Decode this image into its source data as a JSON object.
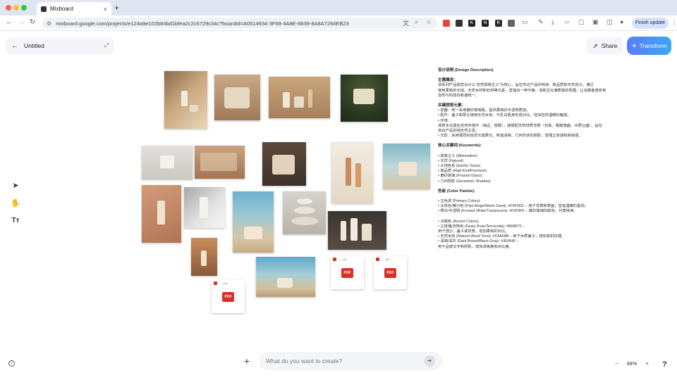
{
  "browser": {
    "tab_title": "Mixboard",
    "tab_close": "×",
    "new_tab": "+",
    "url": "mixboard.google.com/projects/e124a9e102b84bd1bfea2c2c6729c34c?boardId=A0514934-3F68-4A8E-8839-8A8A7284EB23",
    "finish_update": "Finish update",
    "extensions": [
      {
        "name": "pdf-extension-icon",
        "label": "",
        "color": "#e8453c"
      },
      {
        "name": "lock-extension-icon",
        "label": "",
        "color": "#333333"
      },
      {
        "name": "k-extension-icon",
        "label": "K",
        "color": "#222222"
      },
      {
        "name": "n-extension-icon",
        "label": "N",
        "color": "#1e1e1e"
      },
      {
        "name": "k2-extension-icon",
        "label": "K",
        "color": "#2b2b2b"
      },
      {
        "name": "puzzle-extension-icon",
        "label": "",
        "color": "#5f6368"
      }
    ]
  },
  "app": {
    "project_title": "Untitled",
    "share_label": "Share",
    "transform_label": "Transform",
    "prompt_placeholder": "What do you want to create?",
    "zoom_level": "48%",
    "zoom_minus": "−",
    "zoom_plus": "+",
    "help": "?",
    "pdf_label": "PDF",
    "pdf_filename": "......pdf",
    "accent_color": "#4a8ff7"
  },
  "description": [
    {
      "t": "h",
      "text": "设计说明 (Design Description)"
    },
    {
      "t": "gap"
    },
    {
      "t": "h",
      "text": "主题概念："
    },
    {
      "t": "p",
      "text": "该系列产品视觉设计以“自然极简主义”为核心，旨在传达产品的纯净、高品质和天然成分。通过"
    },
    {
      "t": "p",
      "text": "使用柔和的光线、天然木材和石材等元素，营造出一种平静、清新且充满质感的氛围，让消费者感受到"
    },
    {
      "t": "p",
      "text": "自然与科技的和谐统一。"
    },
    {
      "t": "gap"
    },
    {
      "t": "h",
      "text": "关键视觉元素："
    },
    {
      "t": "p",
      "text": "• 容器：统一采用磨砂玻璃瓶，提供柔和的半透明质感。"
    },
    {
      "t": "p",
      "text": "• 配件：盖子和泵头使用天然木色，与乳白瓶身形成对比，增加自然温暖的触感。"
    },
    {
      "t": "p",
      "text": "• 环境："
    },
    {
      "t": "p",
      "text": "场景多设置在自然环境中（海边、苔藓），或搭配天然材质背景（石板、粗糙墙面、木质台面），旨在"
    },
    {
      "t": "p",
      "text": "突出产品的纯天然主张。"
    },
    {
      "t": "p",
      "text": "• 光影：采用强烈的自然光或柔光，制造清晰、几何形状的阴影，增强立体感和高级感。"
    },
    {
      "t": "gap"
    },
    {
      "t": "h",
      "text": "核心关键词 (Keywords):"
    },
    {
      "t": "gap"
    },
    {
      "t": "p",
      "text": "• 极简主义 (Minimalism)"
    },
    {
      "t": "p",
      "text": "• 天然 (Natural)"
    },
    {
      "t": "p",
      "text": "• 大地色系 (Earthy Tones)"
    },
    {
      "t": "p",
      "text": "• 高品质 (High-End/Premium)"
    },
    {
      "t": "p",
      "text": "• 磨砂玻璃 (Frosted Glass)"
    },
    {
      "t": "p",
      "text": "• 几何阴影 (Geometric Shadow)"
    },
    {
      "t": "gap"
    },
    {
      "t": "h",
      "text": "色板 (Color Palette):"
    },
    {
      "t": "gap"
    },
    {
      "t": "p",
      "text": "• 主色调 (Primary Colors):"
    },
    {
      "t": "p",
      "text": "• 淡米色/暖沙色 (Pale Beige/Warm Sand): #F5F0DC – 用于背景和表面，营造温暖的基调。"
    },
    {
      "t": "p",
      "text": "• 雾白/半透明 (Frosted White/Translucent): #F0F8FF – 磨砂玻璃的颜色，代表纯净。"
    },
    {
      "t": "gap"
    },
    {
      "t": "p",
      "text": "• 点缀色 (Accent Colors):"
    },
    {
      "t": "p",
      "text": "• 尘玫瑰/赤陶色 (Dusty Rose/Terracotta): #B68873 –"
    },
    {
      "t": "p",
      "text": "用于部分、盖子或背景，增加柔和的对比。"
    },
    {
      "t": "p",
      "text": "• 天然木色 (Natural Wood Tone): #C8A58B – 用于木质盖子，增加有机纹理。"
    },
    {
      "t": "p",
      "text": "• 深褐/深灰 (Dark Brown/Black-Gray): #36454F –"
    },
    {
      "t": "p",
      "text": "用于品牌文字和阴影，增加清晰度和对比度。"
    }
  ]
}
